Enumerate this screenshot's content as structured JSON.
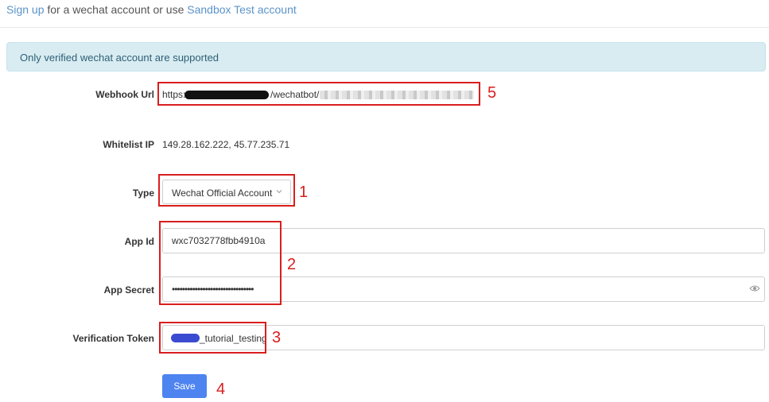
{
  "topbar": {
    "signup_link": "Sign up",
    "middle_text": " for a wechat account or use ",
    "sandbox_link": "Sandbox Test account"
  },
  "alert": {
    "text": "Only verified wechat account are supported"
  },
  "webhook": {
    "label": "Webhook Url",
    "prefix": "https:",
    "middle": "/wechatbot/"
  },
  "whitelist": {
    "label": "Whitelist IP",
    "value": "149.28.162.222, 45.77.235.71"
  },
  "type": {
    "label": "Type",
    "selected": "Wechat Official Account"
  },
  "app_id": {
    "label": "App Id",
    "value": "wxc7032778fbb4910a"
  },
  "app_secret": {
    "label": "App Secret",
    "value": "••••••••••••••••••••••••••••••••"
  },
  "verification_token": {
    "label": "Verification Token",
    "visible_suffix": "_tutorial_testing"
  },
  "save_button": {
    "label": "Save"
  },
  "annotations": {
    "n1": "1",
    "n2": "2",
    "n3": "3",
    "n4": "4",
    "n5": "5"
  },
  "colors": {
    "annotation": "#d91e1e",
    "primary": "#4e84f0",
    "link": "#5b93c8",
    "alert_bg": "#d8ecf2"
  },
  "icons": {
    "select_chevron": "chevron-down-icon",
    "password_toggle": "eye-icon"
  }
}
